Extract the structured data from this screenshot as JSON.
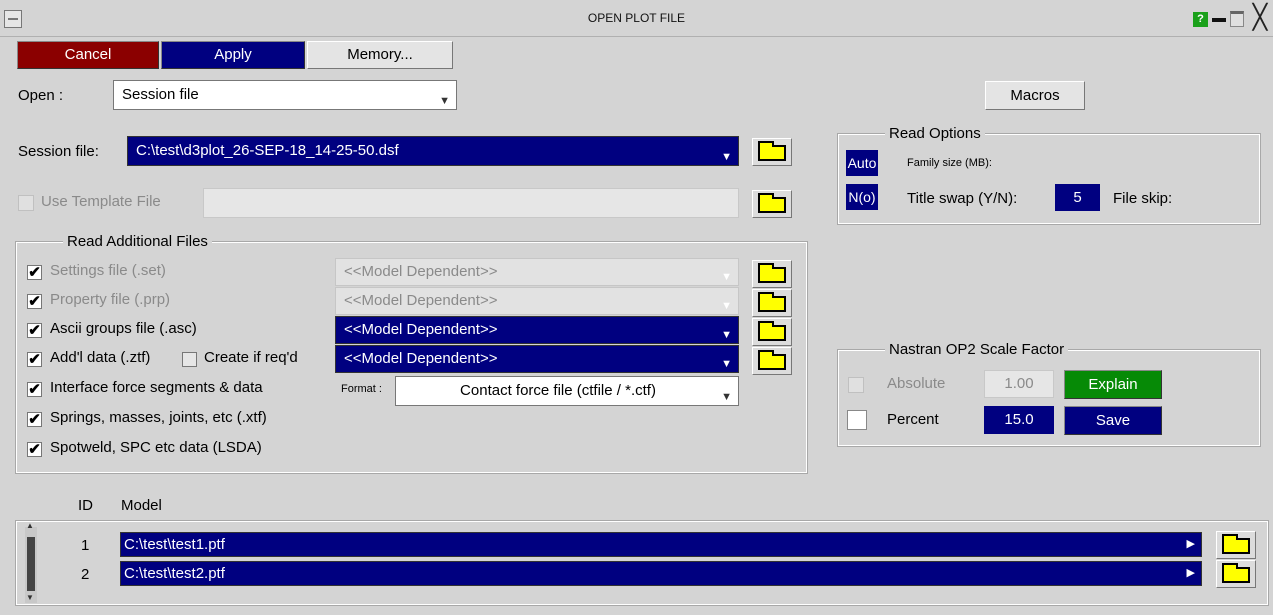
{
  "window": {
    "title": "OPEN PLOT FILE",
    "help_label": "?"
  },
  "toolbar": {
    "cancel_label": "Cancel",
    "apply_label": "Apply",
    "memory_label": "Memory..."
  },
  "open": {
    "label": "Open :",
    "value": "Session file"
  },
  "macros_label": "Macros",
  "session": {
    "label": "Session file:",
    "value": "C:\\test\\d3plot_26-SEP-18_14-25-50.dsf"
  },
  "template": {
    "label": "Use Template File"
  },
  "read_options": {
    "legend": "Read Options",
    "auto_label": "Auto",
    "family_size_label": "Family size (MB):",
    "no_label": "N(o)",
    "title_swap_label": "Title swap (Y/N):",
    "file_skip_value": "5",
    "file_skip_label": "File skip:"
  },
  "additional": {
    "legend": "Read Additional Files",
    "items": [
      {
        "label": "Settings file (.set)",
        "checked": "✔",
        "dropdown": "<<Model Dependent>>"
      },
      {
        "label": "Property file (.prp)",
        "checked": "✔",
        "dropdown": "<<Model Dependent>>"
      },
      {
        "label": "Ascii groups file (.asc)",
        "checked": "✔",
        "dropdown": "<<Model Dependent>>"
      },
      {
        "label": "Add'l data (.ztf)",
        "checked": "✔",
        "dropdown": "<<Model Dependent>>",
        "create_label": "Create if req'd"
      },
      {
        "label": "Interface force segments & data",
        "checked": "✔"
      },
      {
        "label": "Springs, masses, joints, etc (.xtf)",
        "checked": "✔"
      },
      {
        "label": "Spotweld, SPC etc data (LSDA)",
        "checked": "✔"
      }
    ],
    "format_label": "Format :",
    "format_value": "Contact force file (ctfile / *.ctf)"
  },
  "nastran": {
    "legend": "Nastran OP2 Scale Factor",
    "absolute_label": "Absolute",
    "absolute_value": "1.00",
    "explain_label": "Explain",
    "percent_label": "Percent",
    "percent_value": "15.0",
    "save_label": "Save"
  },
  "models": {
    "id_header": "ID",
    "model_header": "Model",
    "rows": [
      {
        "id": "1",
        "path": "C:\\test\\test1.ptf"
      },
      {
        "id": "2",
        "path": "C:\\test\\test2.ptf"
      }
    ]
  },
  "colors": {
    "navy": "#000080",
    "dark_red": "#8b0000",
    "green": "#068a06",
    "folder": "#ffff00",
    "background": "#d4d4d4"
  }
}
